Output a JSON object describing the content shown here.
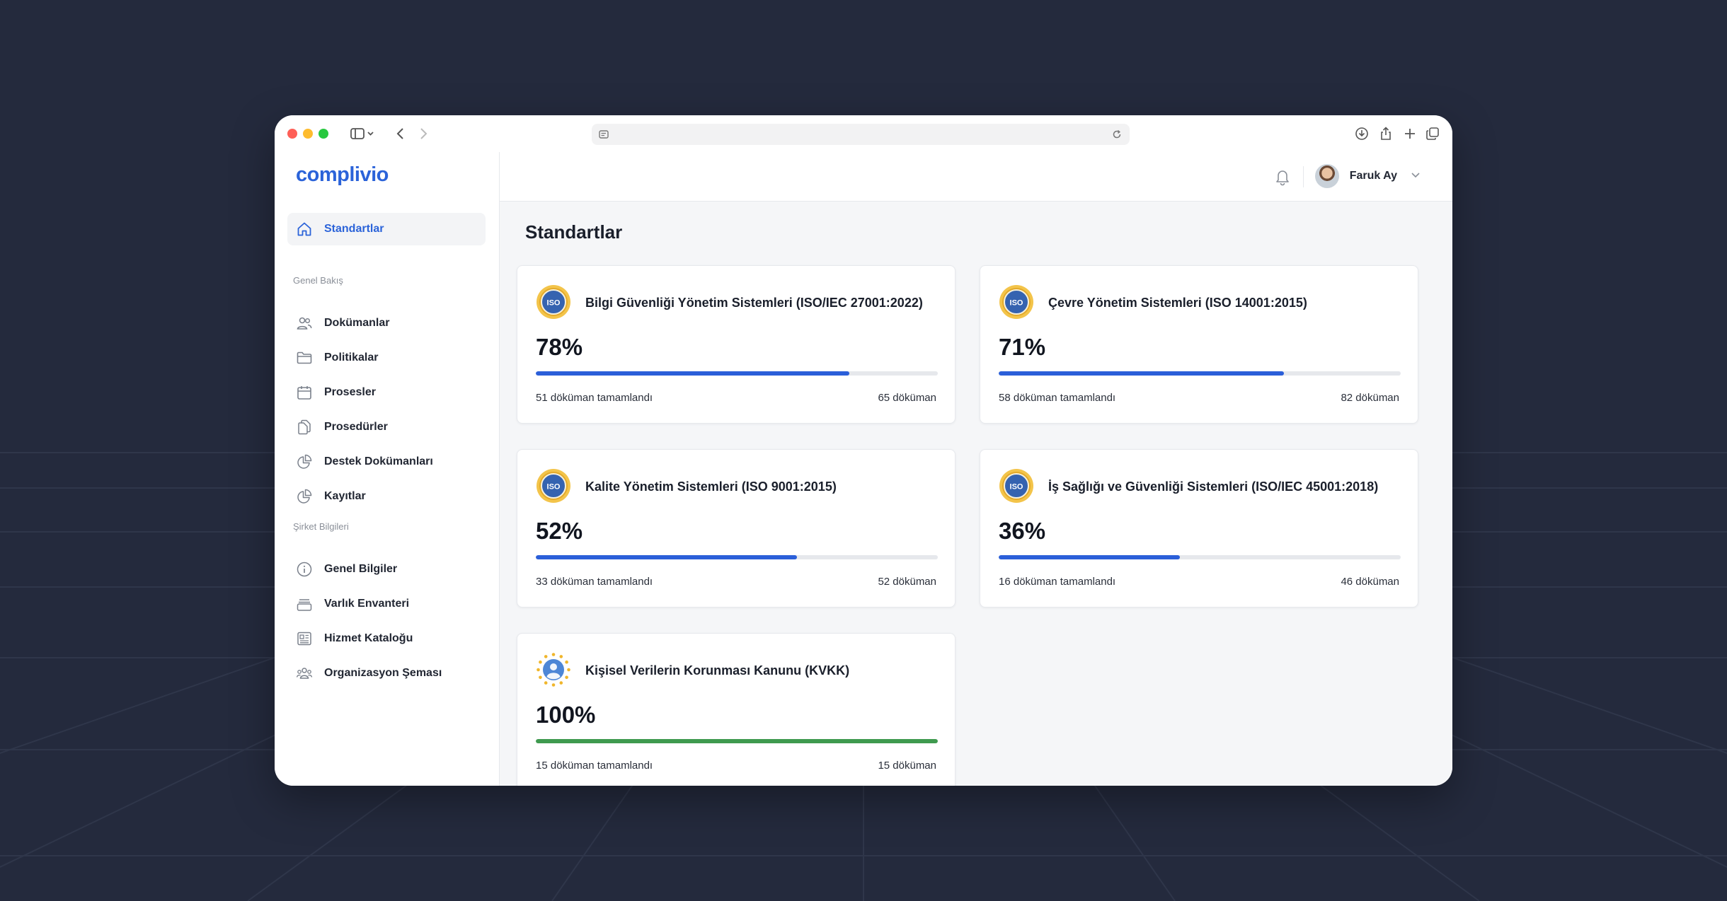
{
  "colors": {
    "accent": "#2b63d9",
    "progress": "#2b5fd9",
    "complete": "#3f9a4f",
    "background": "#242a3d"
  },
  "app": {
    "logo": "complivio"
  },
  "sidebar": {
    "active": {
      "label": "Standartlar",
      "icon": "home-icon"
    },
    "sections": [
      {
        "title": "Genel Bakış",
        "items": [
          {
            "label": "Dokümanlar",
            "icon": "users-icon"
          },
          {
            "label": "Politikalar",
            "icon": "folder-icon"
          },
          {
            "label": "Prosesler",
            "icon": "calendar-icon"
          },
          {
            "label": "Prosedürler",
            "icon": "copy-icon"
          },
          {
            "label": "Destek Dokümanları",
            "icon": "pie-chart-icon"
          },
          {
            "label": "Kayıtlar",
            "icon": "pie-chart-icon"
          }
        ]
      },
      {
        "title": "Şirket Bilgileri",
        "items": [
          {
            "label": "Genel Bilgiler",
            "icon": "info-icon"
          },
          {
            "label": "Varlık Envanteri",
            "icon": "archive-icon"
          },
          {
            "label": "Hizmet Kataloğu",
            "icon": "newspaper-icon"
          },
          {
            "label": "Organizasyon Şeması",
            "icon": "team-icon"
          }
        ]
      }
    ]
  },
  "header": {
    "user_name": "Faruk Ay"
  },
  "main": {
    "title": "Standartlar",
    "cards": [
      {
        "title": "Bilgi Güvenliği Yönetim Sistemleri (ISO/IEC 27001:2022)",
        "percent": "78%",
        "progress": 0.78,
        "completed_text": "51 döküman tamamlandı",
        "total_text": "65 döküman",
        "badge": "ISO",
        "icon": "iso-badge-icon"
      },
      {
        "title": "Çevre Yönetim Sistemleri (ISO 14001:2015)",
        "percent": "71%",
        "progress": 0.71,
        "completed_text": "58 döküman tamamlandı",
        "total_text": "82 döküman",
        "badge": "ISO",
        "icon": "iso-badge-icon"
      },
      {
        "title": "Kalite Yönetim Sistemleri (ISO 9001:2015)",
        "percent": "52%",
        "progress": 0.65,
        "completed_text": "33 döküman tamamlandı",
        "total_text": "52 döküman",
        "badge": "ISO",
        "icon": "iso-badge-icon"
      },
      {
        "title": "İş Sağlığı ve Güvenliği Sistemleri (ISO/IEC 45001:2018)",
        "percent": "36%",
        "progress": 0.45,
        "completed_text": "16 döküman tamamlandı",
        "total_text": "46 döküman",
        "badge": "ISO",
        "icon": "iso-badge-icon"
      },
      {
        "title": "Kişisel Verilerin Korunması Kanunu (KVKK)",
        "percent": "100%",
        "progress": 1.0,
        "completed_text": "15 döküman tamamlandı",
        "total_text": "15 döküman",
        "badge": "",
        "icon": "kvkk-badge-icon"
      }
    ]
  }
}
